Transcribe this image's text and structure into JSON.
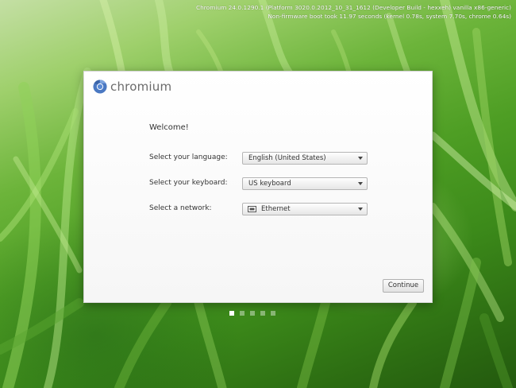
{
  "boot_info": {
    "line1": "Chromium 24.0.1290.1 (Platform 3020.0.2012_10_31_1612 (Developer Build - hexxeh) vanilla x86-generic)",
    "line2": "Non-firmware boot took 11.97 seconds (kernel 0.78s, system 7.70s, chrome 0.64s)"
  },
  "brand": {
    "name": "chromium",
    "icon": "chromium-logo-icon"
  },
  "welcome": {
    "title": "Welcome!"
  },
  "form": {
    "language": {
      "label": "Select your language:",
      "value": "English (United States)"
    },
    "keyboard": {
      "label": "Select your keyboard:",
      "value": "US keyboard"
    },
    "network": {
      "label": "Select a network:",
      "value": "Ethernet",
      "icon": "ethernet-icon"
    }
  },
  "continue_label": "Continue",
  "steps": {
    "total": 5,
    "current": 1
  },
  "colors": {
    "card_background": "#ffffff",
    "brand_text": "#6b6b6b",
    "logo_blue": "#4a78c2",
    "wallpaper_green": "#4e9e24"
  }
}
